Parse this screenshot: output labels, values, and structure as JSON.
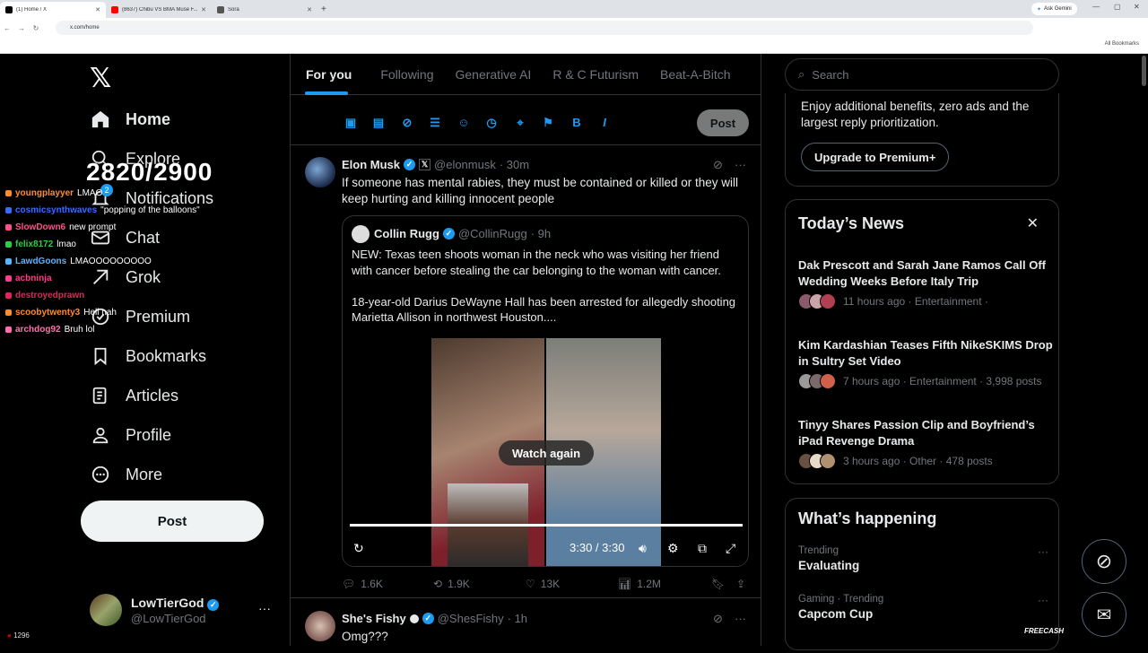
{
  "browser": {
    "tabs": [
      {
        "title": "(1) Home / X",
        "active": true,
        "color": "#000000"
      },
      {
        "title": "(8637) Chibu VS BMA Muse F...",
        "active": false,
        "color": "#ff0000"
      },
      {
        "title": "Sora",
        "active": false,
        "color": "#333333"
      }
    ],
    "ask_gemini": "Ask Gemini",
    "url": "x.com/home",
    "all_bookmarks": "All Bookmarks"
  },
  "overlay": {
    "counter": "2820/2900",
    "chat": [
      {
        "user": "youngplayyer",
        "msg": "LMAO",
        "color": "#ff8c2e"
      },
      {
        "user": "cosmicsynthwaves",
        "msg": "\"popping of the balloons\"",
        "color": "#3a6bff"
      },
      {
        "user": "SlowDown6",
        "msg": "new prompt",
        "color": "#ff4f8b"
      },
      {
        "user": "felix8172",
        "msg": "lmao",
        "color": "#2ecc40"
      },
      {
        "user": "LawdGoons",
        "msg": "LMAOOOOOOOOO",
        "color": "#5ab4ff"
      },
      {
        "user": "acbninja",
        "msg": "",
        "color": "#ff3b8b"
      },
      {
        "user": "destroyedprawn",
        "msg": "",
        "color": "#e0245e"
      },
      {
        "user": "scoobytwenty3",
        "msg": "Hell nah",
        "color": "#ff8c2e"
      },
      {
        "user": "archdog92",
        "msg": "Bruh lol",
        "color": "#ff6fae"
      }
    ],
    "bottom_count": "1296",
    "freecash": "FREECASH"
  },
  "nav": {
    "items": [
      {
        "label": "Home",
        "icon": "home-icon"
      },
      {
        "label": "Explore",
        "icon": "search-icon"
      },
      {
        "label": "Notifications",
        "icon": "bell-icon"
      },
      {
        "label": "Chat",
        "icon": "mail-icon"
      },
      {
        "label": "Grok",
        "icon": "grok-icon"
      },
      {
        "label": "Premium",
        "icon": "premium-icon"
      },
      {
        "label": "Bookmarks",
        "icon": "bookmark-icon"
      },
      {
        "label": "Articles",
        "icon": "article-icon"
      },
      {
        "label": "Profile",
        "icon": "profile-icon"
      },
      {
        "label": "More",
        "icon": "more-icon"
      }
    ],
    "post": "Post",
    "notification_count": "2"
  },
  "account": {
    "name": "LowTierGod",
    "handle": "@LowTierGod"
  },
  "feed": {
    "tabs": [
      "For you",
      "Following",
      "Generative AI",
      "R & C Futurism",
      "Beat-A-Bitch"
    ],
    "composer_post": "Post",
    "tweets": [
      {
        "name": "Elon Musk",
        "handle": "@elonmusk",
        "time": "· 30m",
        "text": "If someone has mental rabies, they must be contained or killed or they will keep hurting and killing innocent people",
        "quote": {
          "name": "Collin Rugg",
          "handle": "@CollinRugg",
          "time": "· 9h",
          "text": "NEW: Texas teen shoots woman in the neck who was visiting her friend with cancer before stealing the car belonging to the woman with cancer.\n\n18-year-old Darius DeWayne Hall has been arrested for allegedly shooting Marietta Allison in northwest Houston....",
          "video": {
            "overlay": "Watch again",
            "time": "3:30 / 3:30",
            "progress": 1.0
          }
        },
        "stats": {
          "replies": "1.6K",
          "reposts": "1.9K",
          "likes": "13K",
          "views": "1.2M"
        }
      },
      {
        "name": "She's Fishy",
        "handle": "@ShesFishy",
        "time": "· 1h",
        "text": "Omg???"
      }
    ]
  },
  "right": {
    "search_placeholder": "Search",
    "premium_text": "Enjoy additional benefits, zero ads and the largest reply prioritization.",
    "premium_button": "Upgrade to Premium+",
    "news_title": "Today’s News",
    "news": [
      {
        "title": "Dak Prescott and Sarah Jane Ramos Call Off Wedding Weeks Before Italy Trip",
        "meta": "11 hours ago · Entertainment ·"
      },
      {
        "title": "Kim Kardashian Teases Fifth NikeSKIMS Drop in Sultry Set Video",
        "meta": "7 hours ago · Entertainment · 3,998 posts"
      },
      {
        "title": "Tinyy Shares Passion Clip and Boyfriend’s iPad Revenge Drama",
        "meta": "3 hours ago · Other · 478 posts"
      }
    ],
    "happening_title": "What’s happening",
    "trends": [
      {
        "context": "Trending",
        "name": "Evaluating"
      },
      {
        "context": "Gaming · Trending",
        "name": "Capcom Cup"
      }
    ]
  }
}
